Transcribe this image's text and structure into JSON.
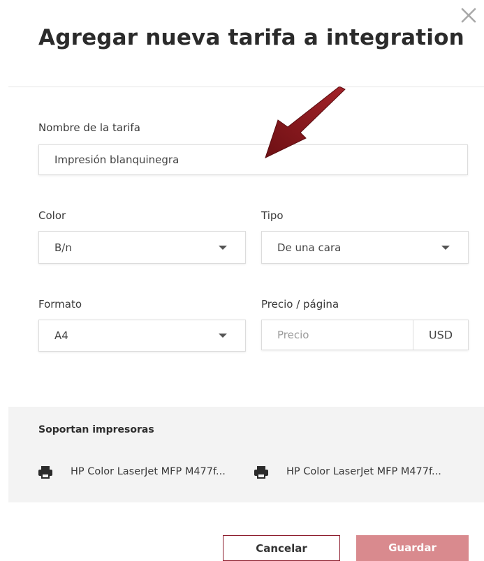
{
  "dialog": {
    "title": "Agregar nueva tarifa a integration"
  },
  "icons": {
    "close": "close-icon",
    "printer": "printer-icon",
    "arrow": "arrow-pointer-icon"
  },
  "form": {
    "name": {
      "label": "Nombre de la tarifa",
      "value": "Impresión blanquinegra"
    },
    "color": {
      "label": "Color",
      "value": "B/n"
    },
    "tipo": {
      "label": "Tipo",
      "value": "De una cara"
    },
    "formato": {
      "label": "Formato",
      "value": "A4"
    },
    "precio": {
      "label": "Precio / página",
      "placeholder": "Precio",
      "currency": "USD"
    }
  },
  "printers": {
    "title": "Soportan impresoras",
    "items": [
      {
        "name": "HP Color LaserJet MFP M477f..."
      },
      {
        "name": "HP Color LaserJet MFP M477f..."
      }
    ]
  },
  "buttons": {
    "cancel": "Cancelar",
    "save": "Guardar"
  },
  "colors": {
    "accent_border": "#8c1c2c",
    "save_bg": "#d98a8e",
    "arrow": "#8b1a1f"
  }
}
